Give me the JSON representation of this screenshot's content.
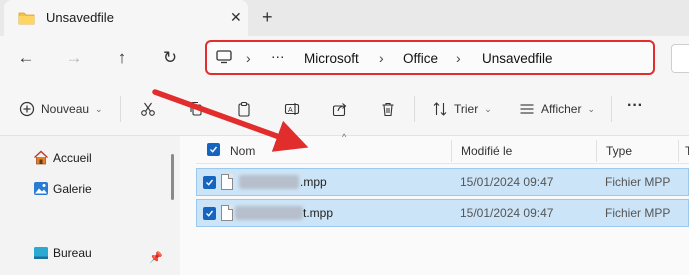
{
  "tab": {
    "title": "Unsavedfile",
    "close_glyph": "✕",
    "new_tab_glyph": "+"
  },
  "nav": {
    "back_glyph": "←",
    "forward_glyph": "→",
    "up_glyph": "↑",
    "refresh_glyph": "↻",
    "address": {
      "ellipsis": "···",
      "crumbs": [
        "Microsoft",
        "Office",
        "Unsavedfile"
      ],
      "separator": "›"
    }
  },
  "toolbar": {
    "new_label": "Nouveau",
    "sort_label": "Trier",
    "view_label": "Afficher",
    "more_glyph": "···",
    "chevron": "⌄"
  },
  "sidebar": {
    "items": [
      {
        "label": "Accueil",
        "icon": "home-icon"
      },
      {
        "label": "Galerie",
        "icon": "gallery-icon"
      },
      {
        "label": "Bureau",
        "icon": "desktop-icon"
      }
    ],
    "pin_glyph": "📌"
  },
  "filelist": {
    "columns": {
      "name": "Nom",
      "modified": "Modifié le",
      "type": "Type",
      "size_partial": "Ta"
    },
    "sort_indicator": "^",
    "rows": [
      {
        "name_visible": ".mpp",
        "modified": "15/01/2024 09:47",
        "type": "Fichier MPP",
        "selected": true
      },
      {
        "name_visible": "t.mpp",
        "modified": "15/01/2024 09:47",
        "type": "Fichier MPP",
        "selected": true
      }
    ]
  },
  "colors": {
    "highlight": "#e22d2d",
    "selection": "#cce4f7",
    "checkbox": "#1565c0"
  }
}
